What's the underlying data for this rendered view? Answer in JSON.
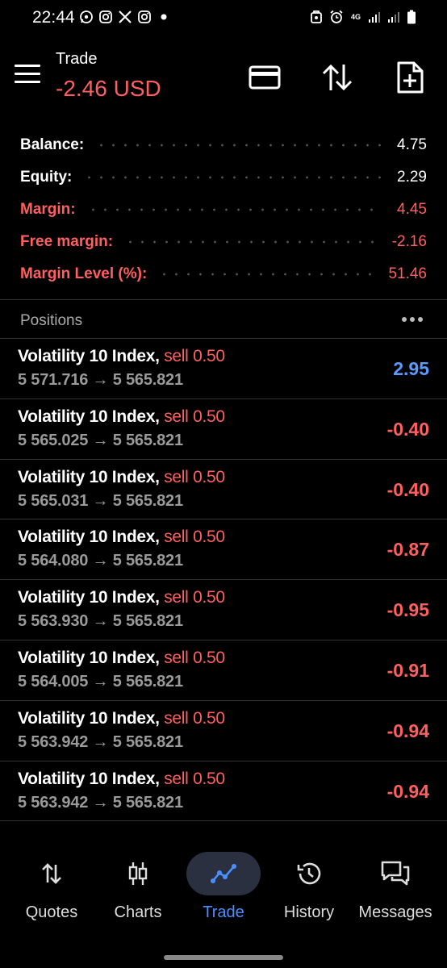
{
  "status_bar": {
    "time": "22:44",
    "notification_icons": [
      "whatsapp-icon",
      "instagram-icon",
      "x-icon",
      "instagram-icon",
      "dot-icon"
    ],
    "system_icons": [
      "secure-folder-icon",
      "alarm-icon",
      "4g-icon",
      "signal-icon",
      "signal-icon",
      "battery-icon"
    ],
    "network": "4G"
  },
  "header": {
    "title": "Trade",
    "profit": "-2.46 USD",
    "icons": [
      "card-icon",
      "sort-arrows-icon",
      "new-order-icon"
    ]
  },
  "summary": {
    "rows": [
      {
        "label": "Balance:",
        "value": "4.75",
        "color": "white"
      },
      {
        "label": "Equity:",
        "value": "2.29",
        "color": "white"
      },
      {
        "label": "Margin:",
        "value": "4.45",
        "color": "red"
      },
      {
        "label": "Free margin:",
        "value": "-2.16",
        "color": "red"
      },
      {
        "label": "Margin Level (%):",
        "value": "51.46",
        "color": "red"
      }
    ]
  },
  "positions": {
    "title": "Positions",
    "items": [
      {
        "symbol": "Volatility 10 Index,",
        "side": "sell 0.50",
        "prices": "5 571.716 → 5 565.821",
        "pl": "2.95",
        "color": "blue"
      },
      {
        "symbol": "Volatility 10 Index,",
        "side": "sell 0.50",
        "prices": "5 565.025 → 5 565.821",
        "pl": "-0.40",
        "color": "red"
      },
      {
        "symbol": "Volatility 10 Index,",
        "side": "sell 0.50",
        "prices": "5 565.031 → 5 565.821",
        "pl": "-0.40",
        "color": "red"
      },
      {
        "symbol": "Volatility 10 Index,",
        "side": "sell 0.50",
        "prices": "5 564.080 → 5 565.821",
        "pl": "-0.87",
        "color": "red"
      },
      {
        "symbol": "Volatility 10 Index,",
        "side": "sell 0.50",
        "prices": "5 563.930 → 5 565.821",
        "pl": "-0.95",
        "color": "red"
      },
      {
        "symbol": "Volatility 10 Index,",
        "side": "sell 0.50",
        "prices": "5 564.005 → 5 565.821",
        "pl": "-0.91",
        "color": "red"
      },
      {
        "symbol": "Volatility 10 Index,",
        "side": "sell 0.50",
        "prices": "5 563.942 → 5 565.821",
        "pl": "-0.94",
        "color": "red"
      },
      {
        "symbol": "Volatility 10 Index,",
        "side": "sell 0.50",
        "prices": "5 563.942 → 5 565.821",
        "pl": "-0.94",
        "color": "red"
      }
    ]
  },
  "bottom_nav": {
    "items": [
      {
        "label": "Quotes",
        "icon": "quotes-icon",
        "active": false
      },
      {
        "label": "Charts",
        "icon": "charts-icon",
        "active": false
      },
      {
        "label": "Trade",
        "icon": "trade-icon",
        "active": true
      },
      {
        "label": "History",
        "icon": "history-icon",
        "active": false
      },
      {
        "label": "Messages",
        "icon": "messages-icon",
        "active": false
      }
    ]
  },
  "colors": {
    "background": "#000000",
    "loss_red": "#ff5f5f",
    "profit_blue": "#5b9bff",
    "active_nav": "#4a8fff",
    "divider": "#333333"
  }
}
